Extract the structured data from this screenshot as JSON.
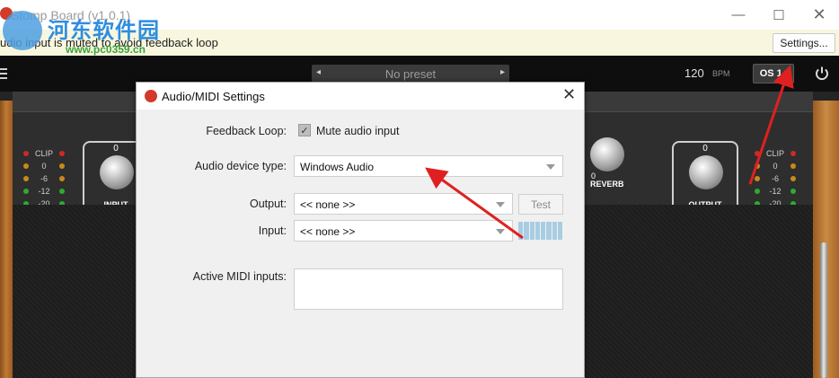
{
  "window": {
    "title": "Stomp Board (v1.0.1)",
    "minimize": "—",
    "maximize": "☐",
    "close": "✕"
  },
  "watermark": {
    "name": "河东软件园",
    "url": "www.pc0359.cn"
  },
  "notice": {
    "message": "udio input is muted to avoid feedback loop",
    "settings_button": "Settings..."
  },
  "toolbar": {
    "preset": "No preset",
    "prev_arrow": "◂",
    "next_arrow": "▸",
    "bpm_value": "120",
    "bpm_unit": "BPM",
    "os_button": "OS 1↑",
    "icons": [
      "menu-icon",
      "power-icon"
    ]
  },
  "plugin": {
    "meter_left": [
      {
        "label": "CLIP",
        "color": "#cc2a2a"
      },
      {
        "label": "0",
        "color": "#c98a1a"
      },
      {
        "label": "-6",
        "color": "#c98a1a"
      },
      {
        "label": "-12",
        "color": "#2faa2f"
      },
      {
        "label": "-20",
        "color": "#2faa2f"
      }
    ],
    "meter_right": [
      {
        "label": "CLIP",
        "color": "#cc2a2a"
      },
      {
        "label": "0",
        "color": "#c98a1a"
      },
      {
        "label": "-6",
        "color": "#c98a1a"
      },
      {
        "label": "-12",
        "color": "#2faa2f"
      },
      {
        "label": "-20",
        "color": "#2faa2f"
      }
    ],
    "input_knob": {
      "zero": "0",
      "name": "INPUT"
    },
    "reverb_label": "REVERB",
    "reverb_zero": "0",
    "output_knob": {
      "zero": "0",
      "name": "OUTPUT"
    }
  },
  "dialog": {
    "title": "Audio/MIDI Settings",
    "close": "✕",
    "feedback_loop_label": "Feedback Loop:",
    "mute_input_label": "Mute audio input",
    "mute_input_checked": true,
    "device_type_label": "Audio device type:",
    "device_type_value": "Windows Audio",
    "output_label": "Output:",
    "output_value": "<< none >>",
    "test_button": "Test",
    "input_label": "Input:",
    "input_value": "<< none >>",
    "midi_inputs_label": "Active MIDI inputs:"
  },
  "colors": {
    "annotation_arrow": "#e02020",
    "notice_bg": "#f8f6de",
    "level_meter": "#a8cde3"
  }
}
